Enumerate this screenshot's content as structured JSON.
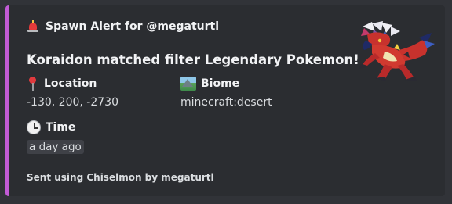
{
  "embed": {
    "accent_color": "#c25bd6",
    "author": {
      "icon": "siren-icon",
      "text": "Spawn Alert for @megaturtl"
    },
    "title": "Koraidon matched filter Legendary Pokemon!",
    "fields": {
      "location": {
        "icon": "round-pushpin-icon",
        "name": "Location",
        "value": "-130, 200, -2730"
      },
      "biome": {
        "icon": "biome-landscape-icon",
        "name": "Biome",
        "value": "minecraft:desert"
      },
      "time": {
        "icon": "clock-icon",
        "name": "Time",
        "value": "a day ago"
      }
    },
    "footer": "Sent using Chiselmon by megaturtl",
    "thumbnail": {
      "icon": "koraidon-sprite"
    }
  }
}
